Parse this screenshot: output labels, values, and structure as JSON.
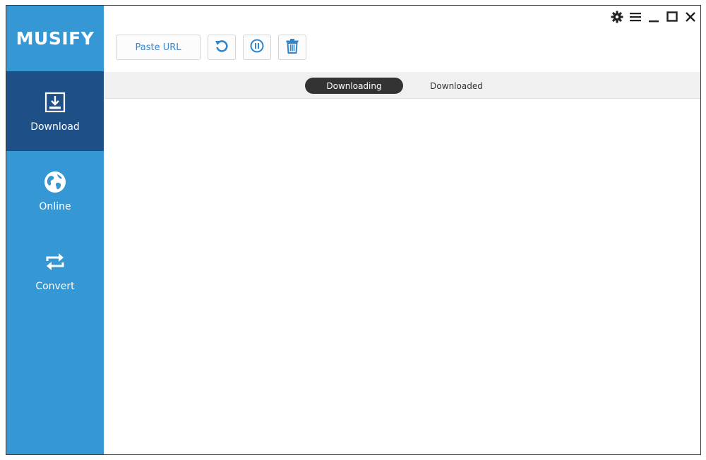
{
  "app": {
    "title": "MUSIFY"
  },
  "sidebar": {
    "items": [
      {
        "label": "Download",
        "icon": "download-icon",
        "active": true
      },
      {
        "label": "Online",
        "icon": "globe-icon",
        "active": false
      },
      {
        "label": "Convert",
        "icon": "convert-icon",
        "active": false
      }
    ]
  },
  "toolbar": {
    "paste_label": "Paste URL",
    "buttons": [
      "refresh-icon",
      "pause-icon",
      "trash-icon"
    ]
  },
  "window_controls": [
    "gear-icon",
    "menu-icon",
    "minimize-icon",
    "maximize-icon",
    "close-icon"
  ],
  "tabs": [
    {
      "label": "Downloading",
      "active": true
    },
    {
      "label": "Downloaded",
      "active": false
    }
  ],
  "colors": {
    "sidebar": "#3597d3",
    "sidebar_active": "#1e4f86",
    "accent": "#3a86c8",
    "tab_active": "#333333"
  }
}
